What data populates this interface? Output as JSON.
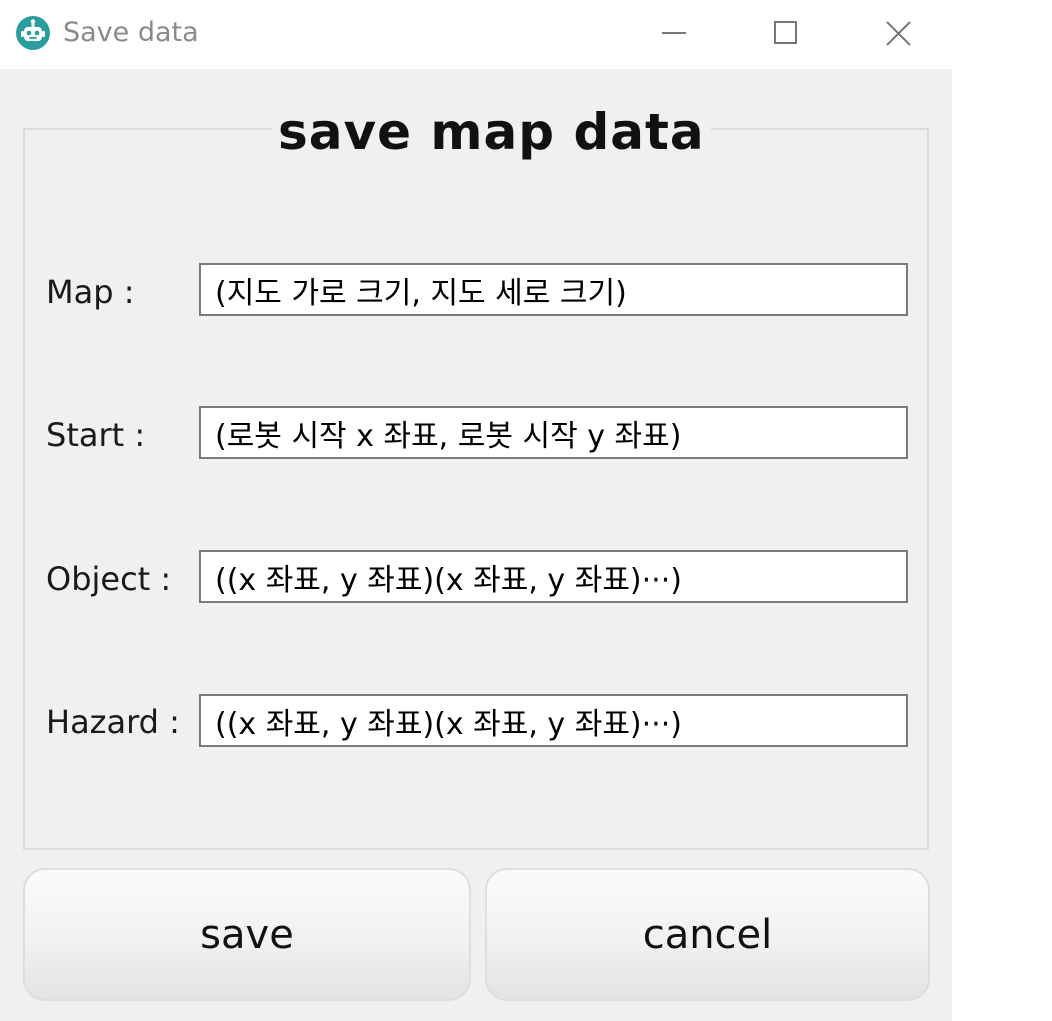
{
  "window": {
    "title": "Save data",
    "app_icon": "robot-icon",
    "controls": {
      "minimize": "minimize-icon",
      "maximize": "maximize-icon",
      "close": "close-icon"
    }
  },
  "form": {
    "group_title": "save map data",
    "fields": [
      {
        "label": "Map :",
        "value": "(지도 가로 크기, 지도 세로 크기)"
      },
      {
        "label": "Start :",
        "value": "(로봇 시작 x 좌표, 로봇 시작 y 좌표)"
      },
      {
        "label": "Object :",
        "value": "((x 좌표, y 좌표)(x 좌표, y 좌표)···)"
      },
      {
        "label": "Hazard :",
        "value": "((x 좌표, y 좌표)(x 좌표, y 좌표)···)"
      }
    ]
  },
  "buttons": {
    "save_label": "save",
    "cancel_label": "cancel"
  },
  "colors": {
    "app_icon": "#2a9d9f",
    "window_bg": "#f0f0f0",
    "titlebar_bg": "#ffffff",
    "input_border": "#7a7a7a"
  }
}
